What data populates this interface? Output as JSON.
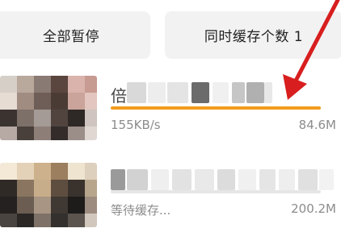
{
  "toolbar": {
    "pause_all_label": "全部暂停",
    "concurrent_label": "同时缓存个数 1"
  },
  "downloads": [
    {
      "title_visible_char": "倍",
      "speed": "155KB/s",
      "size": "84.6M",
      "progress": 1.0,
      "progress_color": "#f39c1f"
    },
    {
      "title_visible_char": "",
      "status": "等待缓存...",
      "size": "200.2M",
      "progress": 0.0,
      "progress_color": "#e6e6e6"
    }
  ],
  "colors": {
    "accent": "#f39c1f",
    "annotation": "#d81e1e",
    "button_bg": "#f2f2f3",
    "meta_text": "#8c8c8c"
  },
  "icons": {
    "annotation": "red-arrow-annotation"
  }
}
